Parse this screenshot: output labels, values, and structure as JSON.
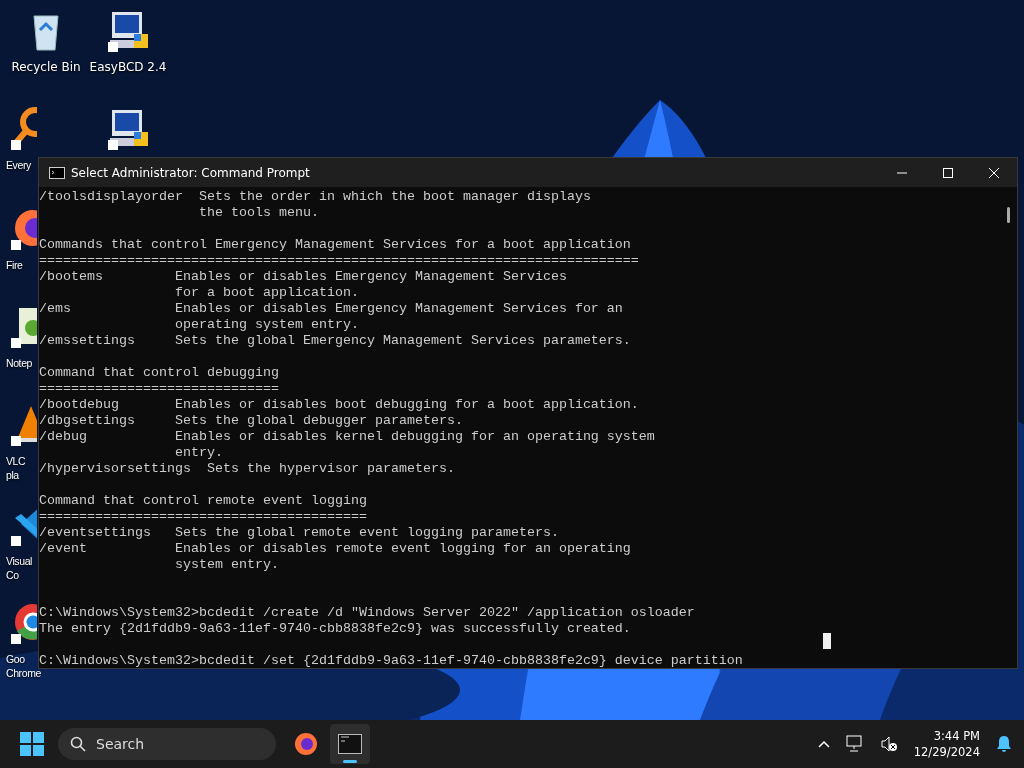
{
  "desktop_icons": [
    {
      "kind": "recycle",
      "lines": [
        "Recycle Bin"
      ]
    },
    {
      "kind": "easybcd",
      "lines": [
        "EasyBCD 2.4"
      ]
    },
    {
      "kind": "search",
      "lines": [
        "Every"
      ]
    },
    {
      "kind": "easyuefi"
    },
    {
      "kind": "firefox",
      "lines": [
        "Fire"
      ]
    },
    {
      "kind": "notepad",
      "lines": [
        "Notep"
      ]
    },
    {
      "kind": "vlc",
      "lines": [
        "VLC",
        "pla"
      ]
    },
    {
      "kind": "vscode",
      "lines": [
        "Visual",
        "Co"
      ]
    },
    {
      "kind": "chrome",
      "lines": [
        "Goo",
        "Chrome"
      ]
    }
  ],
  "window": {
    "title": "Select Administrator: Command Prompt",
    "lines": [
      {
        "kind": "text",
        "text": "/toolsdisplayorder  Sets the order in which the boot manager displays"
      },
      {
        "kind": "text",
        "text": "                    the tools menu."
      },
      {
        "kind": "blank"
      },
      {
        "kind": "text",
        "text": "Commands that control Emergency Management Services for a boot application"
      },
      {
        "kind": "text",
        "text": "==========================================================================="
      },
      {
        "kind": "text",
        "text": "/bootems         Enables or disables Emergency Management Services"
      },
      {
        "kind": "text",
        "text": "                 for a boot application."
      },
      {
        "kind": "text",
        "text": "/ems             Enables or disables Emergency Management Services for an"
      },
      {
        "kind": "text",
        "text": "                 operating system entry."
      },
      {
        "kind": "text",
        "text": "/emssettings     Sets the global Emergency Management Services parameters."
      },
      {
        "kind": "blank"
      },
      {
        "kind": "text",
        "text": "Command that control debugging"
      },
      {
        "kind": "text",
        "text": "=============================="
      },
      {
        "kind": "text",
        "text": "/bootdebug       Enables or disables boot debugging for a boot application."
      },
      {
        "kind": "text",
        "text": "/dbgsettings     Sets the global debugger parameters."
      },
      {
        "kind": "text",
        "text": "/debug           Enables or disables kernel debugging for an operating system"
      },
      {
        "kind": "text",
        "text": "                 entry."
      },
      {
        "kind": "text",
        "text": "/hypervisorsettings  Sets the hypervisor parameters."
      },
      {
        "kind": "blank"
      },
      {
        "kind": "text",
        "text": "Command that control remote event logging"
      },
      {
        "kind": "text",
        "text": "========================================="
      },
      {
        "kind": "text",
        "text": "/eventsettings   Sets the global remote event logging parameters."
      },
      {
        "kind": "text",
        "text": "/event           Enables or disables remote event logging for an operating"
      },
      {
        "kind": "text",
        "text": "                 system entry."
      },
      {
        "kind": "blank"
      },
      {
        "kind": "blank"
      },
      {
        "kind": "text",
        "text": "C:\\Windows\\System32>bcdedit /create /d \"Windows Server 2022\" /application osloader"
      },
      {
        "kind": "text",
        "text": "The entry {2d1fddb9-9a63-11ef-9740-cbb8838fe2c9} was successfully created."
      },
      {
        "kind": "blank"
      },
      {
        "kind": "text",
        "text": "C:\\Windows\\System32>bcdedit /set {2d1fddb9-9a63-11ef-9740-cbb8838fe2c9} device partition"
      }
    ]
  },
  "taskbar": {
    "search": {
      "placeholder": "Search"
    },
    "apps": [
      {
        "kind": "firefox",
        "selected": false
      },
      {
        "kind": "terminal",
        "selected": true
      }
    ],
    "time": "3:44 PM",
    "date": "12/29/2024"
  }
}
